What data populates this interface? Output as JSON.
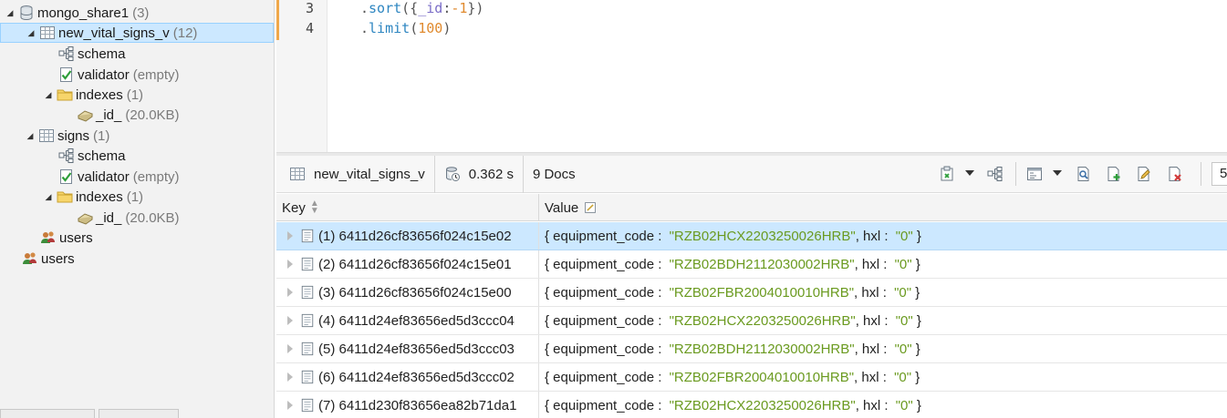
{
  "tree": {
    "items": [
      {
        "label": "mongo_share1",
        "count": "(3)",
        "icon": "database-icon",
        "expanded": true
      },
      {
        "label": "new_vital_signs_v",
        "count": "(12)",
        "icon": "collection-icon",
        "expanded": true,
        "selected": true
      },
      {
        "label": "schema",
        "count": "",
        "icon": "schema-icon"
      },
      {
        "label": "validator",
        "count": "(empty)",
        "icon": "validator-icon"
      },
      {
        "label": "indexes",
        "count": "(1)",
        "icon": "folder-icon",
        "expanded": true
      },
      {
        "label": "_id_",
        "count": "(20.0KB)",
        "icon": "index-icon"
      },
      {
        "label": "signs",
        "count": "(1)",
        "icon": "collection-icon",
        "expanded": true
      },
      {
        "label": "schema",
        "count": "",
        "icon": "schema-icon"
      },
      {
        "label": "validator",
        "count": "(empty)",
        "icon": "validator-icon"
      },
      {
        "label": "indexes",
        "count": "(1)",
        "icon": "folder-icon",
        "expanded": true
      },
      {
        "label": "_id_",
        "count": "(20.0KB)",
        "icon": "index-icon"
      },
      {
        "label": "users",
        "count": "",
        "icon": "users-icon"
      },
      {
        "label": "users",
        "count": "",
        "icon": "users-icon"
      }
    ]
  },
  "editor": {
    "lines": [
      {
        "number": "3",
        "text": "  .sort({_id:-1})"
      },
      {
        "number": "4",
        "text": "  .limit(100)"
      }
    ]
  },
  "results": {
    "collection": "new_vital_signs_v",
    "time": "0.362 s",
    "docs": "9 Docs",
    "page": "5",
    "columns": {
      "key": "Key",
      "value": "Value"
    },
    "rows": [
      {
        "key": "(1) 6411d26cf83656f024c15e02",
        "equipment_code": "\"RZB02HCX2203250026HRB\"",
        "hxl": "\"0\""
      },
      {
        "key": "(2) 6411d26cf83656f024c15e01",
        "equipment_code": "\"RZB02BDH2112030002HRB\"",
        "hxl": "\"0\""
      },
      {
        "key": "(3) 6411d26cf83656f024c15e00",
        "equipment_code": "\"RZB02FBR2004010010HRB\"",
        "hxl": "\"0\""
      },
      {
        "key": "(4) 6411d24ef83656ed5d3ccc04",
        "equipment_code": "\"RZB02HCX2203250026HRB\"",
        "hxl": "\"0\""
      },
      {
        "key": "(5) 6411d24ef83656ed5d3ccc03",
        "equipment_code": "\"RZB02BDH2112030002HRB\"",
        "hxl": "\"0\""
      },
      {
        "key": "(6) 6411d24ef83656ed5d3ccc02",
        "equipment_code": "\"RZB02FBR2004010010HRB\"",
        "hxl": "\"0\""
      },
      {
        "key": "(7) 6411d230f83656ea82b71da1",
        "equipment_code": "\"RZB02HCX2203250026HRB\"",
        "hxl": "\"0\""
      }
    ],
    "value_prefix": "{ equipment_code : ",
    "value_mid": ", hxl : ",
    "value_suffix": " }"
  },
  "colors": {
    "selection": "#cce8ff",
    "string_value": "#6a9a1f",
    "accent_gutter": "#f0a84a"
  }
}
